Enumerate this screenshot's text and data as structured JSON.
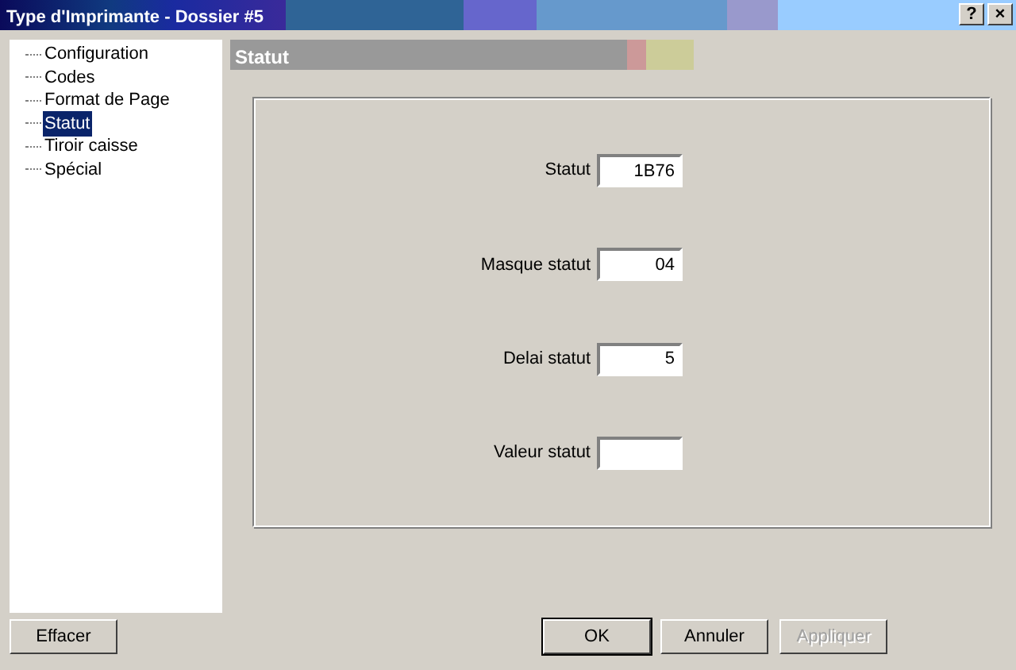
{
  "window": {
    "title": "Type d'Imprimante - Dossier #5",
    "help_button": "?",
    "close_button": "×"
  },
  "tree": {
    "items": [
      {
        "label": "Configuration",
        "selected": false
      },
      {
        "label": "Codes",
        "selected": false
      },
      {
        "label": "Format de Page",
        "selected": false
      },
      {
        "label": "Statut",
        "selected": true
      },
      {
        "label": "Tiroir caisse",
        "selected": false
      },
      {
        "label": "Spécial",
        "selected": false
      }
    ]
  },
  "section": {
    "title": "Statut"
  },
  "fields": [
    {
      "label": "Statut",
      "value": "1B76"
    },
    {
      "label": "Masque statut",
      "value": "04"
    },
    {
      "label": "Delai statut",
      "value": "5"
    },
    {
      "label": "Valeur statut"
    }
  ],
  "buttons": [
    {
      "label": "Effacer",
      "disabled": false,
      "default": false
    },
    {
      "label": "OK",
      "disabled": false,
      "default": true
    },
    {
      "label": "Annuler",
      "disabled": false,
      "default": false
    },
    {
      "label": "Appliquer",
      "disabled": true,
      "default": false
    }
  ]
}
